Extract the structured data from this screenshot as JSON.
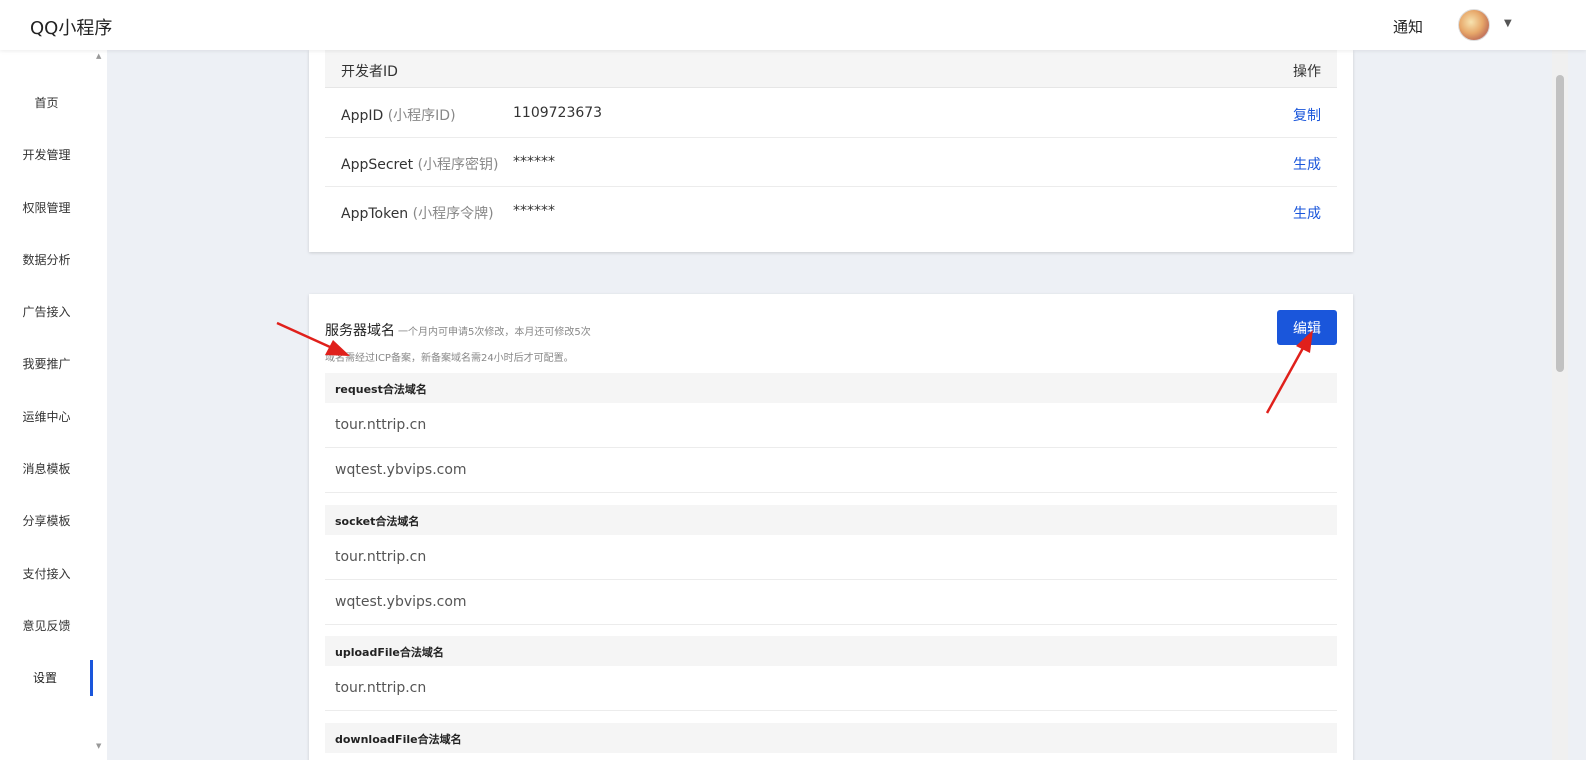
{
  "header": {
    "app_title": "QQ小程序",
    "notify_label": "通知"
  },
  "sidebar": {
    "items": [
      {
        "label": "首页"
      },
      {
        "label": "开发管理"
      },
      {
        "label": "权限管理"
      },
      {
        "label": "数据分析"
      },
      {
        "label": "广告接入"
      },
      {
        "label": "我要推广"
      },
      {
        "label": "运维中心"
      },
      {
        "label": "消息模板"
      },
      {
        "label": "分享模板"
      },
      {
        "label": "支付接入"
      },
      {
        "label": "意见反馈"
      },
      {
        "label": "设置"
      }
    ],
    "active": "设置"
  },
  "developer": {
    "col_id": "开发者ID",
    "col_action": "操作",
    "rows": [
      {
        "label": "AppID",
        "sub": "(小程序ID)",
        "value": "1109723673",
        "action": "复制"
      },
      {
        "label": "AppSecret",
        "sub": "(小程序密钥)",
        "value": "******",
        "action": "生成"
      },
      {
        "label": "AppToken",
        "sub": "(小程序令牌)",
        "value": "******",
        "action": "生成"
      }
    ]
  },
  "server_domain": {
    "title": "服务器域名",
    "note": "一个月内可申请5次修改，本月还可修改5次",
    "hint": "域名需经过ICP备案，新备案域名需24小时后才可配置。",
    "edit_label": "编辑",
    "sections": [
      {
        "name": "request合法域名",
        "domains": [
          "tour.nttrip.cn",
          "wqtest.ybvips.com"
        ]
      },
      {
        "name": "socket合法域名",
        "domains": [
          "tour.nttrip.cn",
          "wqtest.ybvips.com"
        ]
      },
      {
        "name": "uploadFile合法域名",
        "domains": [
          "tour.nttrip.cn"
        ]
      },
      {
        "name": "downloadFile合法域名",
        "domains": []
      }
    ]
  },
  "colors": {
    "accent": "#1a56db",
    "annotation": "#e0201b",
    "background": "#edf0f5"
  }
}
